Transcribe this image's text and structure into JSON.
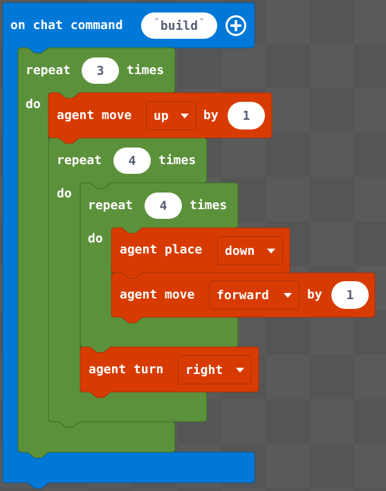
{
  "colors": {
    "event_block": "#0078d7",
    "loop_block": "#5c913b",
    "agent_block": "#d83b01",
    "field_text": "#575e75"
  },
  "event": {
    "label": "on chat command",
    "command": "build",
    "add_icon": "plus-circle-icon"
  },
  "outer_repeat": {
    "label": "repeat",
    "count": "3",
    "times": "times",
    "do": "do"
  },
  "move_up": {
    "label": "agent move",
    "direction": "up",
    "by": "by",
    "amount": "1"
  },
  "mid_repeat": {
    "label": "repeat",
    "count": "4",
    "times": "times",
    "do": "do"
  },
  "inner_repeat": {
    "label": "repeat",
    "count": "4",
    "times": "times",
    "do": "do"
  },
  "place": {
    "label": "agent place",
    "direction": "down"
  },
  "move_forward": {
    "label": "agent move",
    "direction": "forward",
    "by": "by",
    "amount": "1"
  },
  "turn": {
    "label": "agent turn",
    "direction": "right"
  }
}
